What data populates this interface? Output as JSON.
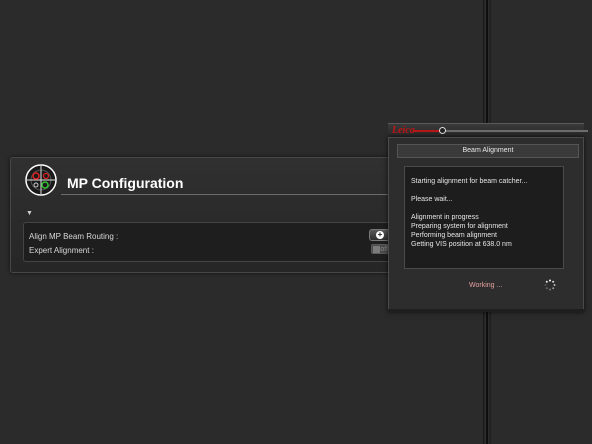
{
  "mp_panel": {
    "title": "MP Configuration",
    "rows": [
      {
        "label": "Align MP Beam Routing :"
      },
      {
        "label": "Expert Alignment :"
      }
    ],
    "toggle_label": "off",
    "plus_label": "+"
  },
  "dialog": {
    "logo": "Leica",
    "title": "Beam Alignment",
    "log_lines": [
      "Starting alignment for  beam catcher...",
      "",
      "Please wait...",
      "",
      "Alignment in progress",
      "Preparing system for alignment",
      "Performing beam alignment",
      "Getting VIS position at 638.0 nm"
    ],
    "status": "Working ..."
  },
  "colors": {
    "background": "#2b2b2b",
    "brand_red": "#c21515",
    "status_text": "#e7a0a0"
  }
}
